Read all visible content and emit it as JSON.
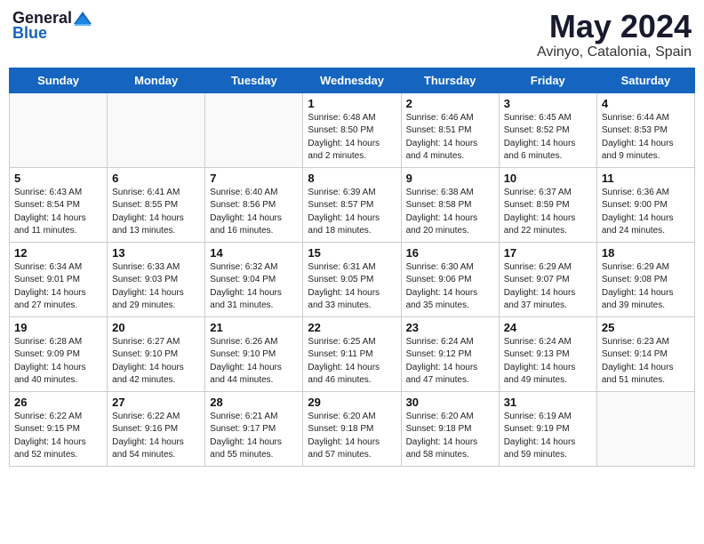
{
  "header": {
    "logo_general": "General",
    "logo_blue": "Blue",
    "month": "May 2024",
    "location": "Avinyo, Catalonia, Spain"
  },
  "weekdays": [
    "Sunday",
    "Monday",
    "Tuesday",
    "Wednesday",
    "Thursday",
    "Friday",
    "Saturday"
  ],
  "weeks": [
    [
      {
        "day": "",
        "info": ""
      },
      {
        "day": "",
        "info": ""
      },
      {
        "day": "",
        "info": ""
      },
      {
        "day": "1",
        "info": "Sunrise: 6:48 AM\nSunset: 8:50 PM\nDaylight: 14 hours\nand 2 minutes."
      },
      {
        "day": "2",
        "info": "Sunrise: 6:46 AM\nSunset: 8:51 PM\nDaylight: 14 hours\nand 4 minutes."
      },
      {
        "day": "3",
        "info": "Sunrise: 6:45 AM\nSunset: 8:52 PM\nDaylight: 14 hours\nand 6 minutes."
      },
      {
        "day": "4",
        "info": "Sunrise: 6:44 AM\nSunset: 8:53 PM\nDaylight: 14 hours\nand 9 minutes."
      }
    ],
    [
      {
        "day": "5",
        "info": "Sunrise: 6:43 AM\nSunset: 8:54 PM\nDaylight: 14 hours\nand 11 minutes."
      },
      {
        "day": "6",
        "info": "Sunrise: 6:41 AM\nSunset: 8:55 PM\nDaylight: 14 hours\nand 13 minutes."
      },
      {
        "day": "7",
        "info": "Sunrise: 6:40 AM\nSunset: 8:56 PM\nDaylight: 14 hours\nand 16 minutes."
      },
      {
        "day": "8",
        "info": "Sunrise: 6:39 AM\nSunset: 8:57 PM\nDaylight: 14 hours\nand 18 minutes."
      },
      {
        "day": "9",
        "info": "Sunrise: 6:38 AM\nSunset: 8:58 PM\nDaylight: 14 hours\nand 20 minutes."
      },
      {
        "day": "10",
        "info": "Sunrise: 6:37 AM\nSunset: 8:59 PM\nDaylight: 14 hours\nand 22 minutes."
      },
      {
        "day": "11",
        "info": "Sunrise: 6:36 AM\nSunset: 9:00 PM\nDaylight: 14 hours\nand 24 minutes."
      }
    ],
    [
      {
        "day": "12",
        "info": "Sunrise: 6:34 AM\nSunset: 9:01 PM\nDaylight: 14 hours\nand 27 minutes."
      },
      {
        "day": "13",
        "info": "Sunrise: 6:33 AM\nSunset: 9:03 PM\nDaylight: 14 hours\nand 29 minutes."
      },
      {
        "day": "14",
        "info": "Sunrise: 6:32 AM\nSunset: 9:04 PM\nDaylight: 14 hours\nand 31 minutes."
      },
      {
        "day": "15",
        "info": "Sunrise: 6:31 AM\nSunset: 9:05 PM\nDaylight: 14 hours\nand 33 minutes."
      },
      {
        "day": "16",
        "info": "Sunrise: 6:30 AM\nSunset: 9:06 PM\nDaylight: 14 hours\nand 35 minutes."
      },
      {
        "day": "17",
        "info": "Sunrise: 6:29 AM\nSunset: 9:07 PM\nDaylight: 14 hours\nand 37 minutes."
      },
      {
        "day": "18",
        "info": "Sunrise: 6:29 AM\nSunset: 9:08 PM\nDaylight: 14 hours\nand 39 minutes."
      }
    ],
    [
      {
        "day": "19",
        "info": "Sunrise: 6:28 AM\nSunset: 9:09 PM\nDaylight: 14 hours\nand 40 minutes."
      },
      {
        "day": "20",
        "info": "Sunrise: 6:27 AM\nSunset: 9:10 PM\nDaylight: 14 hours\nand 42 minutes."
      },
      {
        "day": "21",
        "info": "Sunrise: 6:26 AM\nSunset: 9:10 PM\nDaylight: 14 hours\nand 44 minutes."
      },
      {
        "day": "22",
        "info": "Sunrise: 6:25 AM\nSunset: 9:11 PM\nDaylight: 14 hours\nand 46 minutes."
      },
      {
        "day": "23",
        "info": "Sunrise: 6:24 AM\nSunset: 9:12 PM\nDaylight: 14 hours\nand 47 minutes."
      },
      {
        "day": "24",
        "info": "Sunrise: 6:24 AM\nSunset: 9:13 PM\nDaylight: 14 hours\nand 49 minutes."
      },
      {
        "day": "25",
        "info": "Sunrise: 6:23 AM\nSunset: 9:14 PM\nDaylight: 14 hours\nand 51 minutes."
      }
    ],
    [
      {
        "day": "26",
        "info": "Sunrise: 6:22 AM\nSunset: 9:15 PM\nDaylight: 14 hours\nand 52 minutes."
      },
      {
        "day": "27",
        "info": "Sunrise: 6:22 AM\nSunset: 9:16 PM\nDaylight: 14 hours\nand 54 minutes."
      },
      {
        "day": "28",
        "info": "Sunrise: 6:21 AM\nSunset: 9:17 PM\nDaylight: 14 hours\nand 55 minutes."
      },
      {
        "day": "29",
        "info": "Sunrise: 6:20 AM\nSunset: 9:18 PM\nDaylight: 14 hours\nand 57 minutes."
      },
      {
        "day": "30",
        "info": "Sunrise: 6:20 AM\nSunset: 9:18 PM\nDaylight: 14 hours\nand 58 minutes."
      },
      {
        "day": "31",
        "info": "Sunrise: 6:19 AM\nSunset: 9:19 PM\nDaylight: 14 hours\nand 59 minutes."
      },
      {
        "day": "",
        "info": ""
      }
    ]
  ]
}
